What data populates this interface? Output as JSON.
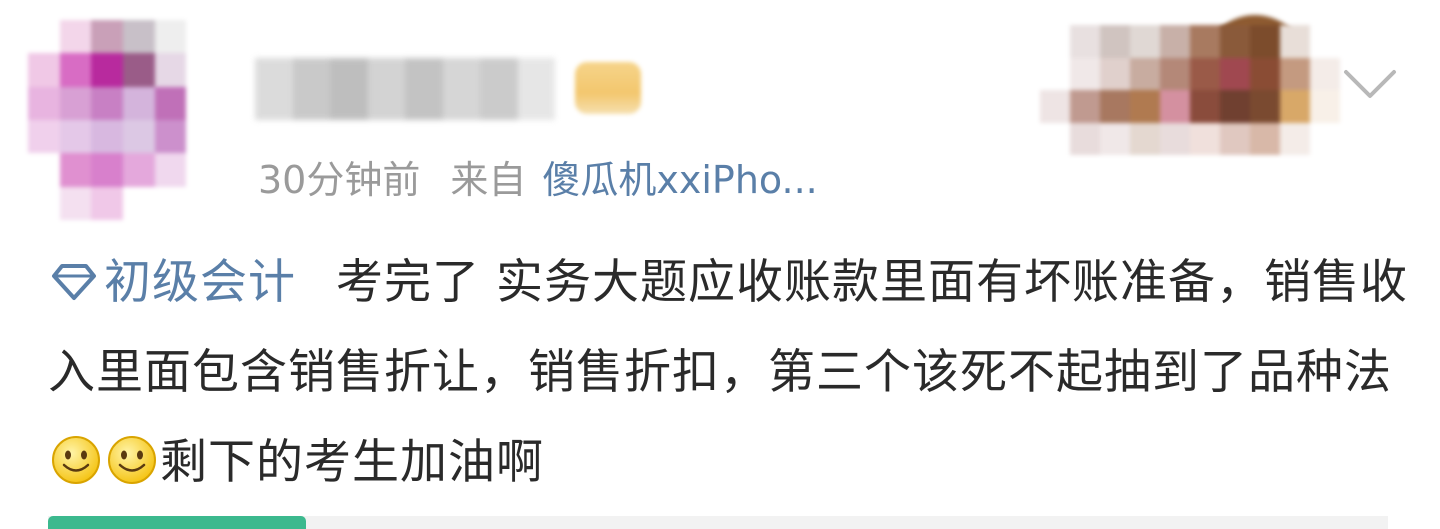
{
  "post": {
    "time": "30分钟前",
    "from_label": "来自",
    "source": "傻瓜机xxiPho...",
    "topic": "初级会计",
    "text_part1": "考完了 实务大题应收账款里面有坏账准备，销售收入里面包含销售折让，销售折扣，第三个该死不起抽到了品种法",
    "text_part2": "剩下的考生加油啊"
  },
  "icons": {
    "topic_icon": "diamond-icon",
    "emoji": "smile-emoji-icon",
    "menu": "chevron-down-icon"
  },
  "colors": {
    "link": "#5a7fa8",
    "meta": "#9a9a9a",
    "accent": "#3cb98e"
  }
}
